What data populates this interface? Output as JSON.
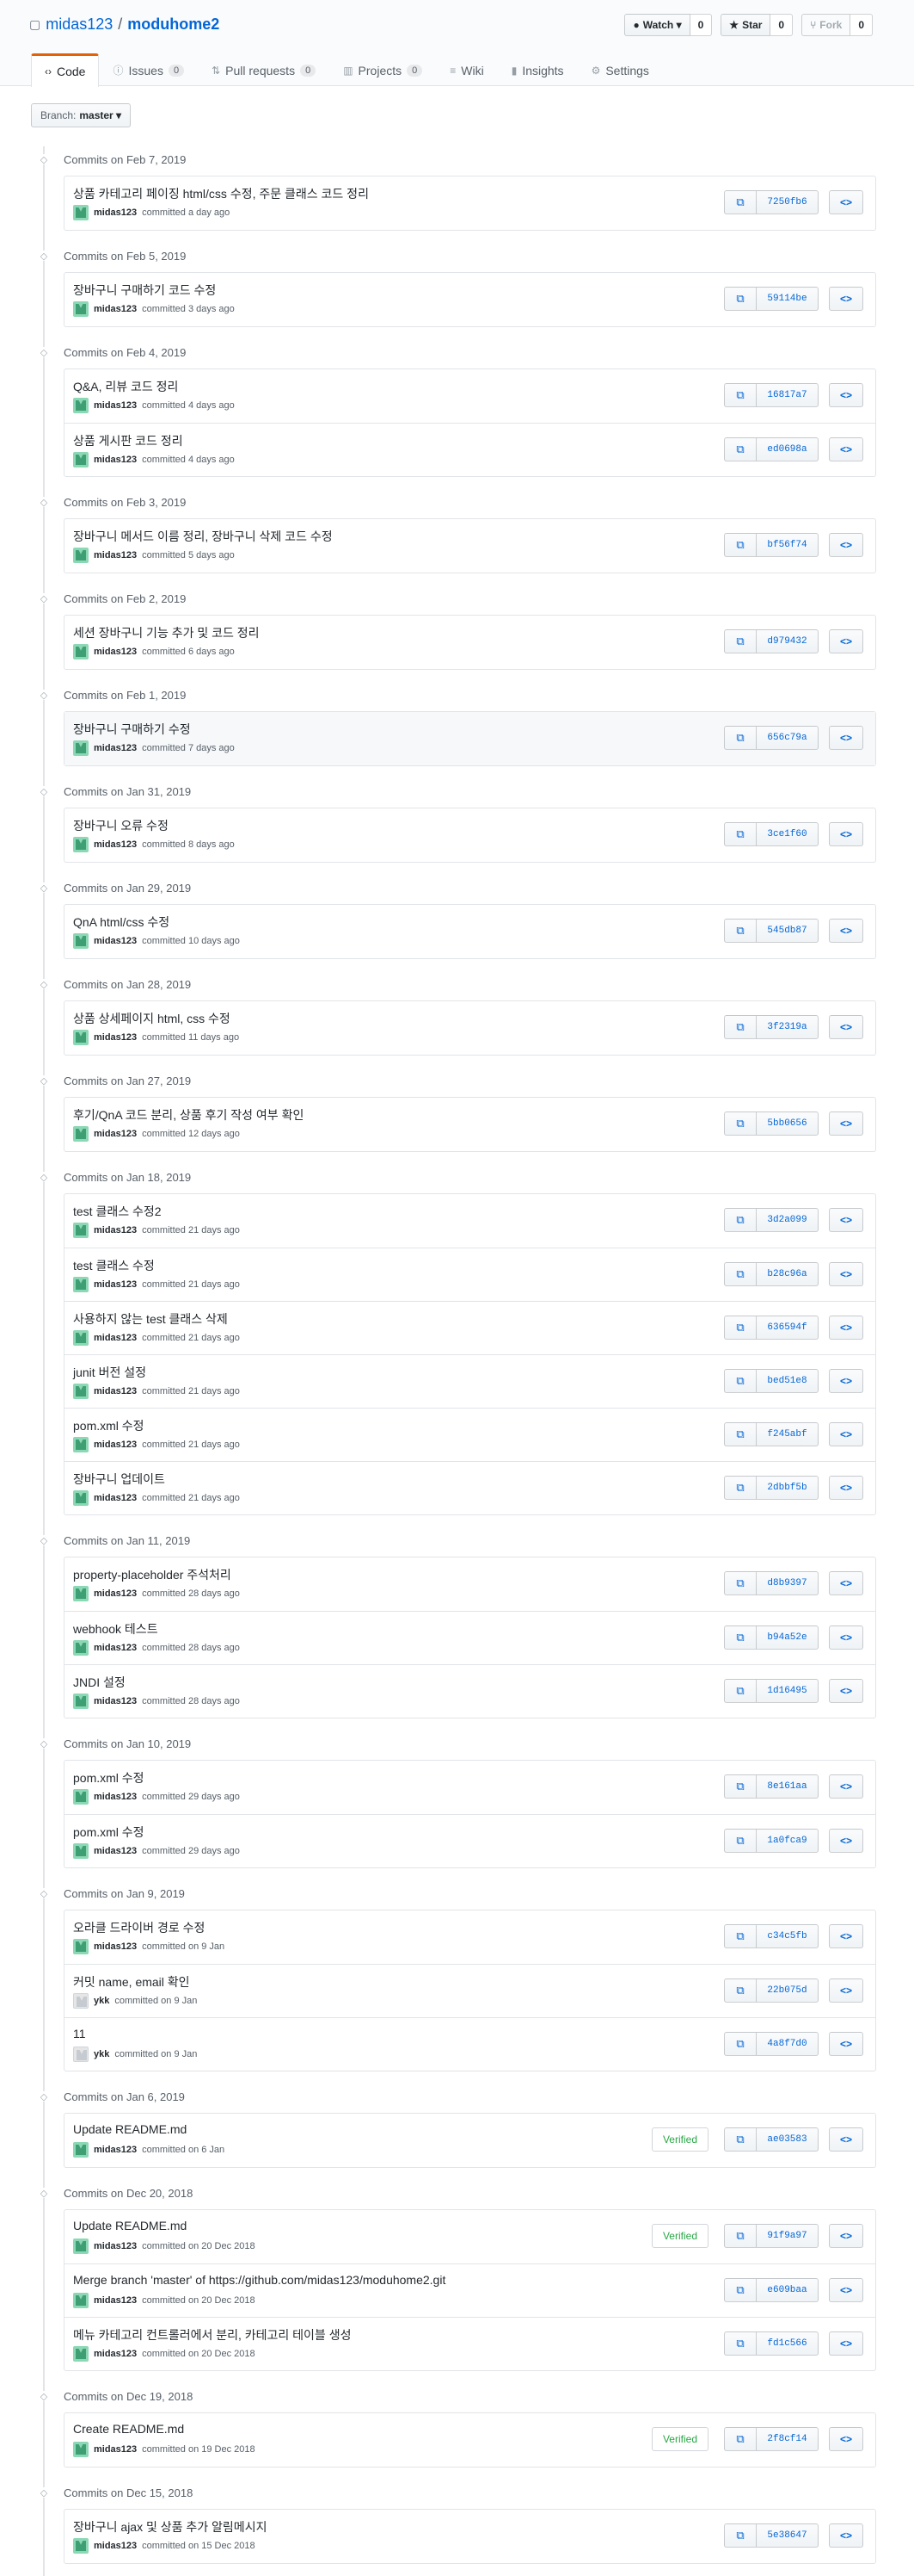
{
  "repo": {
    "owner": "midas123",
    "separator": "/",
    "name": "moduhome2"
  },
  "actions": [
    {
      "icon": "eye-icon",
      "glyph": "●",
      "label": "Watch ▾",
      "count": "0",
      "disabled": false
    },
    {
      "icon": "star-icon",
      "glyph": "★",
      "label": "Star",
      "count": "0",
      "disabled": false
    },
    {
      "icon": "fork-icon",
      "glyph": "⑂",
      "label": "Fork",
      "count": "0",
      "disabled": true
    }
  ],
  "nav": [
    {
      "icon": "code-icon",
      "glyph": "‹›",
      "label": "Code",
      "counter": null,
      "selected": true
    },
    {
      "icon": "issue-icon",
      "glyph": "ⓘ",
      "label": "Issues",
      "counter": "0",
      "selected": false
    },
    {
      "icon": "pull-request-icon",
      "glyph": "⇅",
      "label": "Pull requests",
      "counter": "0",
      "selected": false
    },
    {
      "icon": "project-icon",
      "glyph": "▥",
      "label": "Projects",
      "counter": "0",
      "selected": false
    },
    {
      "icon": "wiki-icon",
      "glyph": "≡",
      "label": "Wiki",
      "counter": null,
      "selected": false
    },
    {
      "icon": "graph-icon",
      "glyph": "▮",
      "label": "Insights",
      "counter": null,
      "selected": false
    },
    {
      "icon": "gear-icon",
      "glyph": "⚙",
      "label": "Settings",
      "counter": null,
      "selected": false
    }
  ],
  "branch": {
    "prefix": "Branch:",
    "name": "master ▾"
  },
  "groups": [
    {
      "title": "Commits on Feb 7, 2019",
      "commits": [
        {
          "title": "상품 카테고리 페이징 html/css 수정, 주문 클래스 코드 정리",
          "author": "midas123",
          "time": "committed a day ago",
          "sha": "7250fb6"
        }
      ]
    },
    {
      "title": "Commits on Feb 5, 2019",
      "commits": [
        {
          "title": "장바구니 구매하기 코드 수정",
          "author": "midas123",
          "time": "committed 3 days ago",
          "sha": "59114be"
        }
      ]
    },
    {
      "title": "Commits on Feb 4, 2019",
      "commits": [
        {
          "title": "Q&A, 리뷰 코드 정리",
          "author": "midas123",
          "time": "committed 4 days ago",
          "sha": "16817a7"
        },
        {
          "title": "상품 게시판 코드 정리",
          "author": "midas123",
          "time": "committed 4 days ago",
          "sha": "ed0698a"
        }
      ]
    },
    {
      "title": "Commits on Feb 3, 2019",
      "commits": [
        {
          "title": "장바구니 메서드 이름 정리, 장바구니 삭제 코드 수정",
          "author": "midas123",
          "time": "committed 5 days ago",
          "sha": "bf56f74"
        }
      ]
    },
    {
      "title": "Commits on Feb 2, 2019",
      "commits": [
        {
          "title": "세션 장바구니 기능 추가 및 코드 정리",
          "author": "midas123",
          "time": "committed 6 days ago",
          "sha": "d979432"
        }
      ]
    },
    {
      "title": "Commits on Feb 1, 2019",
      "commits": [
        {
          "title": "장바구니 구매하기 수정",
          "author": "midas123",
          "time": "committed 7 days ago",
          "sha": "656c79a",
          "highlight": true
        }
      ]
    },
    {
      "title": "Commits on Jan 31, 2019",
      "commits": [
        {
          "title": "장바구니 오류 수정",
          "author": "midas123",
          "time": "committed 8 days ago",
          "sha": "3ce1f60"
        }
      ]
    },
    {
      "title": "Commits on Jan 29, 2019",
      "commits": [
        {
          "title": "QnA html/css 수정",
          "author": "midas123",
          "time": "committed 10 days ago",
          "sha": "545db87"
        }
      ]
    },
    {
      "title": "Commits on Jan 28, 2019",
      "commits": [
        {
          "title": "상품 상세페이지 html, css 수정",
          "author": "midas123",
          "time": "committed 11 days ago",
          "sha": "3f2319a"
        }
      ]
    },
    {
      "title": "Commits on Jan 27, 2019",
      "commits": [
        {
          "title": "후기/QnA 코드 분리, 상품 후기 작성 여부 확인",
          "author": "midas123",
          "time": "committed 12 days ago",
          "sha": "5bb0656"
        }
      ]
    },
    {
      "title": "Commits on Jan 18, 2019",
      "commits": [
        {
          "title": "test 클래스 수정2",
          "author": "midas123",
          "time": "committed 21 days ago",
          "sha": "3d2a099"
        },
        {
          "title": "test 클래스 수정",
          "author": "midas123",
          "time": "committed 21 days ago",
          "sha": "b28c96a"
        },
        {
          "title": "사용하지 않는 test 클래스 삭제",
          "author": "midas123",
          "time": "committed 21 days ago",
          "sha": "636594f"
        },
        {
          "title": "junit 버전 설정",
          "author": "midas123",
          "time": "committed 21 days ago",
          "sha": "bed51e8"
        },
        {
          "title": "pom.xml 수정",
          "author": "midas123",
          "time": "committed 21 days ago",
          "sha": "f245abf"
        },
        {
          "title": "장바구니 업데이트",
          "author": "midas123",
          "time": "committed 21 days ago",
          "sha": "2dbbf5b"
        }
      ]
    },
    {
      "title": "Commits on Jan 11, 2019",
      "commits": [
        {
          "title": "property-placeholder 주석처리",
          "author": "midas123",
          "time": "committed 28 days ago",
          "sha": "d8b9397"
        },
        {
          "title": "webhook 테스트",
          "author": "midas123",
          "time": "committed 28 days ago",
          "sha": "b94a52e"
        },
        {
          "title": "JNDI 설정",
          "author": "midas123",
          "time": "committed 28 days ago",
          "sha": "1d16495"
        }
      ]
    },
    {
      "title": "Commits on Jan 10, 2019",
      "commits": [
        {
          "title": "pom.xml 수정",
          "author": "midas123",
          "time": "committed 29 days ago",
          "sha": "8e161aa"
        },
        {
          "title": "pom.xml 수정",
          "author": "midas123",
          "time": "committed 29 days ago",
          "sha": "1a0fca9"
        }
      ]
    },
    {
      "title": "Commits on Jan 9, 2019",
      "commits": [
        {
          "title": "오라클 드라이버 경로 수정",
          "author": "midas123",
          "time": "committed on 9 Jan",
          "sha": "c34c5fb"
        },
        {
          "title": "커밋 name, email 확인",
          "author": "ykk",
          "time": "committed on 9 Jan",
          "sha": "22b075d",
          "gray": true
        },
        {
          "title": "11",
          "author": "ykk",
          "time": "committed on 9 Jan",
          "sha": "4a8f7d0",
          "gray": true
        }
      ]
    },
    {
      "title": "Commits on Jan 6, 2019",
      "commits": [
        {
          "title": "Update README.md",
          "author": "midas123",
          "time": "committed on 6 Jan",
          "sha": "ae03583",
          "verified": "Verified"
        }
      ]
    },
    {
      "title": "Commits on Dec 20, 2018",
      "commits": [
        {
          "title": "Update README.md",
          "author": "midas123",
          "time": "committed on 20 Dec 2018",
          "sha": "91f9a97",
          "verified": "Verified"
        },
        {
          "title": "Merge branch 'master' of https://github.com/midas123/moduhome2.git",
          "author": "midas123",
          "time": "committed on 20 Dec 2018",
          "sha": "e609baa"
        },
        {
          "title": "메뉴 카테고리 컨트롤러에서 분리, 카테고리 테이블 생성",
          "author": "midas123",
          "time": "committed on 20 Dec 2018",
          "sha": "fd1c566"
        }
      ]
    },
    {
      "title": "Commits on Dec 19, 2018",
      "commits": [
        {
          "title": "Create README.md",
          "author": "midas123",
          "time": "committed on 19 Dec 2018",
          "sha": "2f8cf14",
          "verified": "Verified"
        }
      ]
    },
    {
      "title": "Commits on Dec 15, 2018",
      "commits": [
        {
          "title": "장바구니 ajax 및 상품 추가 알림메시지",
          "author": "midas123",
          "time": "committed on 15 Dec 2018",
          "sha": "5e38647"
        }
      ]
    }
  ]
}
